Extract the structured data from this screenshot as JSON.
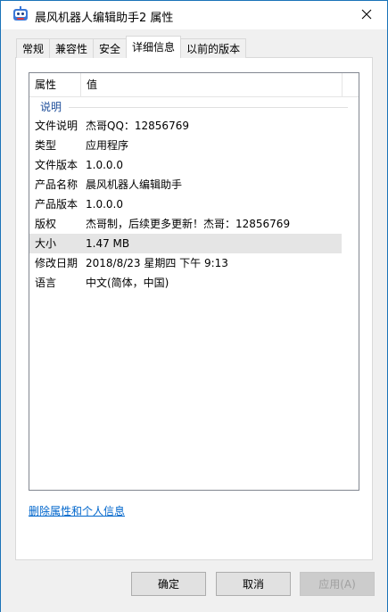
{
  "window": {
    "title": "晨风机器人编辑助手2 属性",
    "close_icon": "close-icon"
  },
  "tabs": [
    {
      "label": "常规"
    },
    {
      "label": "兼容性"
    },
    {
      "label": "安全"
    },
    {
      "label": "详细信息",
      "active": true
    },
    {
      "label": "以前的版本"
    }
  ],
  "listview": {
    "headers": {
      "property": "属性",
      "value": "值"
    },
    "group": "说明",
    "rows": [
      {
        "property": "文件说明",
        "value": "杰哥QQ：12856769"
      },
      {
        "property": "类型",
        "value": "应用程序"
      },
      {
        "property": "文件版本",
        "value": "1.0.0.0"
      },
      {
        "property": "产品名称",
        "value": "晨风机器人编辑助手"
      },
      {
        "property": "产品版本",
        "value": "1.0.0.0"
      },
      {
        "property": "版权",
        "value": "杰哥制，后续更多更新！杰哥：12856769"
      },
      {
        "property": "大小",
        "value": "1.47 MB"
      },
      {
        "property": "修改日期",
        "value": "2018/8/23 星期四 下午 9:13"
      },
      {
        "property": "语言",
        "value": "中文(简体，中国)"
      }
    ]
  },
  "remove_link": "删除属性和个人信息",
  "buttons": {
    "ok": "确定",
    "cancel": "取消",
    "apply": "应用(A)"
  }
}
